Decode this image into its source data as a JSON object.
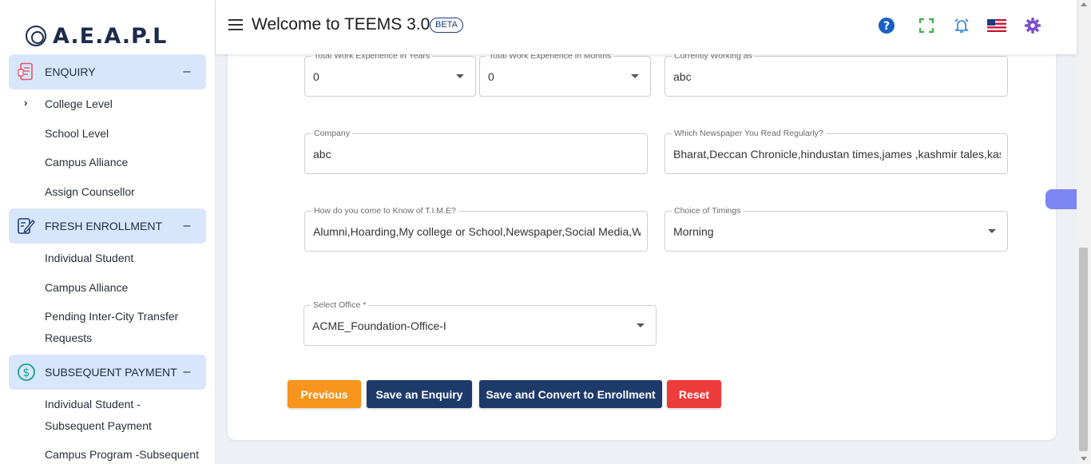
{
  "brand": {
    "logo_text": "A.E.A.P.L"
  },
  "header": {
    "title": "Welcome to TEEMS 3.0",
    "badge": "BETA"
  },
  "sidebar": {
    "sections": [
      {
        "label": "ENQUIRY",
        "toggle": "–",
        "items": [
          "College Level",
          "School Level",
          "Campus Alliance",
          "Assign Counsellor"
        ]
      },
      {
        "label": "FRESH ENROLLMENT",
        "toggle": "–",
        "items": [
          "Individual Student",
          "Campus Alliance",
          "Pending Inter-City Transfer",
          "Requests"
        ]
      },
      {
        "label": "SUBSEQUENT PAYMENT",
        "toggle": "–",
        "items": [
          "Individual Student -",
          "Subsequent Payment",
          "Campus Program -Subsequent"
        ]
      }
    ]
  },
  "form": {
    "exp_years": {
      "label": "Total Work Experience in Years",
      "value": "0"
    },
    "exp_months": {
      "label": "Total Work Experience in Months",
      "value": "0"
    },
    "working_as": {
      "label": "Currently Working as",
      "value": "abc"
    },
    "company": {
      "label": "Company",
      "value": "abc"
    },
    "newspaper": {
      "label": "Which Newspaper You Read Regularly?",
      "value": "Bharat,Deccan Chronicle,hindustan times,james ,kashmir tales,kas"
    },
    "know_of": {
      "label": "How do you come to Know of T.I.M.E?",
      "value": "Alumni,Hoarding,My college or School,Newspaper,Social Media,Wa"
    },
    "timings": {
      "label": "Choice of Timings",
      "value": "Morning"
    },
    "office": {
      "label": "Select Office *",
      "value": "ACME_Foundation-Office-I"
    }
  },
  "buttons": {
    "previous": "Previous",
    "save_enquiry": "Save an Enquiry",
    "save_convert": "Save and Convert to Enrollment",
    "reset": "Reset"
  },
  "colors": {
    "previous": "#f7941d",
    "primary": "#1e3a6b",
    "reset": "#ee3b3b",
    "sidebar_active": "#d8e6fb"
  }
}
